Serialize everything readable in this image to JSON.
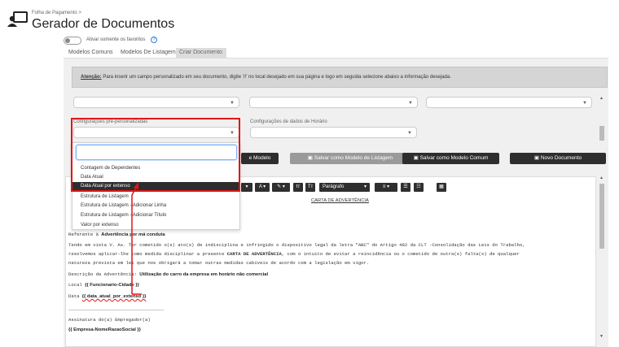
{
  "header": {
    "breadcrumb": "Folha de Pagamento  >",
    "title": "Gerador de Documentos"
  },
  "favorites_toggle": {
    "label": "Ativar somente os favoritos",
    "checked": false
  },
  "tabs": [
    {
      "label": "Modelos Comuns",
      "active": false
    },
    {
      "label": "Modelos De Listagem",
      "active": false
    },
    {
      "label": "Criar Documento",
      "active": true
    }
  ],
  "alert": {
    "strong": "Atenção:",
    "text": " Para inserir um campo personalizado em seu documento, digite '//' no local desejado em sua página e logo em seguida selecione abaixo a informação desejada."
  },
  "fields": {
    "preconfig_label": "Configurações pré-personalizadas",
    "schedule_label": "Configurações de dados de Horário"
  },
  "buttons": {
    "save_model": "e Modelo",
    "save_listing": "Salvar como Modelo de Listagem",
    "save_common": "Salvar como Modelo Comum",
    "new_document": "Novo Documento"
  },
  "toolbar": {
    "paragraph": "Parágrafo"
  },
  "dropdown": {
    "search_value": "",
    "items": [
      "Contagem de Dependentes",
      "Data Atual",
      "Data Atual por extenso",
      "Estrutura de Listagem",
      "Estrutura de Listagem - Adicionar Linha",
      "Estrutura de Listagem - Adicionar Título",
      "Valor por extenso"
    ],
    "highlighted_index": 2
  },
  "document": {
    "heading": "CARTA DE ADVERTÊNCIA",
    "ref_label": "Referente à",
    "ref_value": "Advertência por má conduta",
    "body_1": "Tendo em vista V. As. Ter cometido o(s) ato(s) de indisciplina e infringido o dispositivo legal da letra \"ABC\" do Artigo 482 da CLT -Consolidação das Leis do Trabalho,",
    "body_2a": "resolvemos aplicar-lhe como medida disciplinar a presente ",
    "body_2b": "CARTA DE ADVERTÊNCIA",
    "body_2c": ", com o intuito de evitar a reincidência ou o cometido de outra(s) falta(s) de qualquer",
    "body_3": "natureza prevista em lei que nos obrigará a tomar outras medidas cabíveis de acordo com a legislação em vigor.",
    "desc_label": "Descrição da Advertência:",
    "desc_value": "Utilização do carro da empresa em horário não comercial",
    "local_label": "Local",
    "local_value": "{{ Funcionario-Cidade }}",
    "date_label": "Data",
    "date_value": "{{ data_atual_por_extenso }}",
    "divider": "___________________________________",
    "sign_label": "Assinatura do(a) Empregador(a)",
    "company_value": "{{ Empresa-NomeRazaoSocial }}"
  },
  "colors": {
    "annotation_red": "#e01616",
    "toolbar_dark": "#2f2f2f",
    "button_gray": "#9a9a9a",
    "button_dark": "#2e2e2e"
  }
}
